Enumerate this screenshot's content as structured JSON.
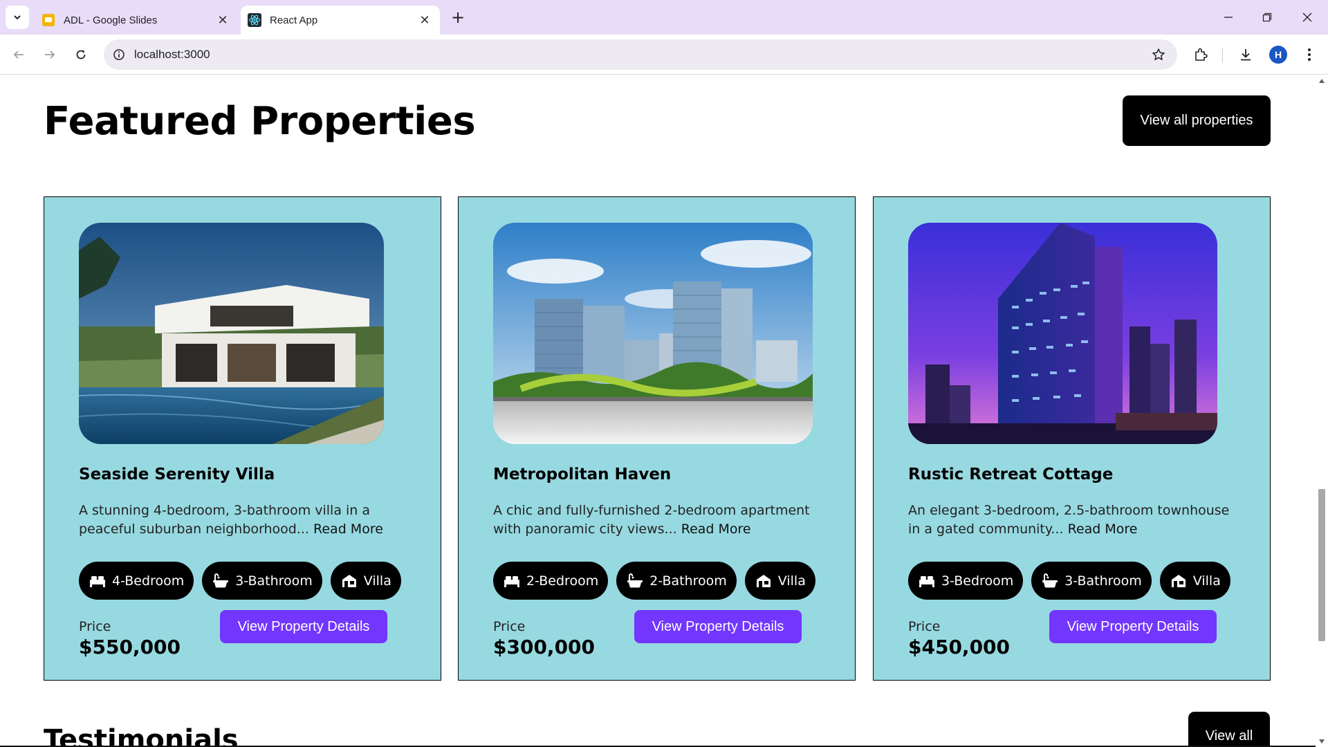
{
  "browser": {
    "tabs": [
      {
        "title": "ADL - Google Slides",
        "favicon": "google-slides-icon",
        "active": false
      },
      {
        "title": "React App",
        "favicon": "react-icon",
        "active": true
      }
    ],
    "address": "localhost:3000",
    "profile_initial": "H"
  },
  "featured": {
    "title": "Featured Properties",
    "view_all_label": "View all properties",
    "price_label": "Price",
    "details_button_label": "View Property Details",
    "read_more": "Read More",
    "cards": [
      {
        "name": "Seaside Serenity Villa",
        "description": "A stunning 4-bedroom, 3-bathroom villa in a peaceful suburban neighborhood...",
        "chips": {
          "bedroom": "4-Bedroom",
          "bathroom": "3-Bathroom",
          "type": "Villa"
        },
        "price": "$550,000",
        "image": "modern-villa-with-pool"
      },
      {
        "name": "Metropolitan Haven",
        "description": "A chic and fully-furnished 2-bedroom apartment with panoramic city views...",
        "chips": {
          "bedroom": "2-Bedroom",
          "bathroom": "2-Bathroom",
          "type": "Villa"
        },
        "price": "$300,000",
        "image": "city-apartment-towers"
      },
      {
        "name": "Rustic Retreat Cottage",
        "description": "An elegant 3-bedroom, 2.5-bathroom townhouse in a gated community...",
        "chips": {
          "bedroom": "3-Bedroom",
          "bathroom": "3-Bathroom",
          "type": "Villa"
        },
        "price": "$450,000",
        "image": "night-skyscraper"
      }
    ]
  },
  "testimonials": {
    "title": "Testimonials",
    "view_all_label": "View all"
  },
  "colors": {
    "card_bg": "#97d9e1",
    "accent": "#7236ff",
    "chip_bg": "#000000",
    "tabbar_bg": "#e8dcf8"
  }
}
